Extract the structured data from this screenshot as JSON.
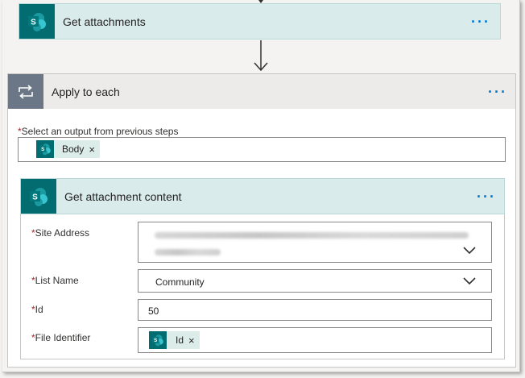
{
  "get_attachments": {
    "title": "Get attachments",
    "more": "···"
  },
  "apply_each": {
    "title": "Apply to each",
    "more": "···",
    "select_label": "Select an output from previous steps",
    "required_mark": "*",
    "token": "Body",
    "token_close": "×"
  },
  "attachment_content": {
    "title": "Get attachment content",
    "more": "···",
    "fields": {
      "site_address": {
        "label": "Site Address"
      },
      "list_name": {
        "label": "List Name",
        "value": "Community"
      },
      "id": {
        "label": "Id",
        "value": "50"
      },
      "file_identifier": {
        "label": "File Identifier",
        "token": "Id",
        "token_close": "×"
      }
    }
  },
  "icons": {
    "sharepoint": "sharepoint-icon",
    "loop": "loop-icon",
    "arrow": "arrow-down-icon",
    "chevron": "chevron-down-icon",
    "more": "more-icon"
  },
  "colors": {
    "sharepoint": "#036c70",
    "header_bg": "#d9ebea",
    "apply_icon_bg": "#6b7787",
    "link_blue": "#0078d4",
    "required_red": "#a4262c"
  }
}
